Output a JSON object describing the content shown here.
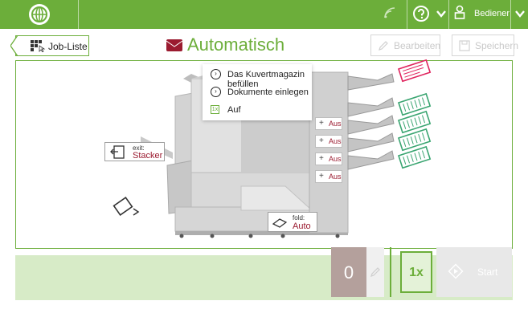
{
  "topbar": {
    "user_label": "Bediener",
    "icons": [
      "globe-icon",
      "wifi-icon",
      "help-icon",
      "chevron-down-icon",
      "user-icon",
      "chevron-down-icon"
    ]
  },
  "header": {
    "back_label": "Job-Liste",
    "title": "Automatisch",
    "edit_label": "Bearbeiten",
    "save_label": "Speichern"
  },
  "menu": {
    "items": [
      {
        "label": "Das Kuvertmagazin befüllen",
        "icon": "circle-arrow-icon"
      },
      {
        "label": "Dokumente einlegen",
        "icon": "circle-arrow-icon"
      },
      {
        "label": "Auf",
        "icon": "1x"
      }
    ]
  },
  "feeders": {
    "items": [
      {
        "label": "Aus"
      },
      {
        "label": "Aus"
      },
      {
        "label": "Aus"
      },
      {
        "label": "Aus"
      }
    ]
  },
  "exit": {
    "small": "exit:",
    "big": "Stacker"
  },
  "fold": {
    "small": "fold:",
    "big": "Auto"
  },
  "bottom": {
    "count": "0",
    "multiplier": "1x",
    "start_label": "Start"
  },
  "colors": {
    "accent": "#6cae3a",
    "value_red": "#9b1b30",
    "envelope_pink": "#e0245e",
    "document_green": "#3aa571"
  }
}
